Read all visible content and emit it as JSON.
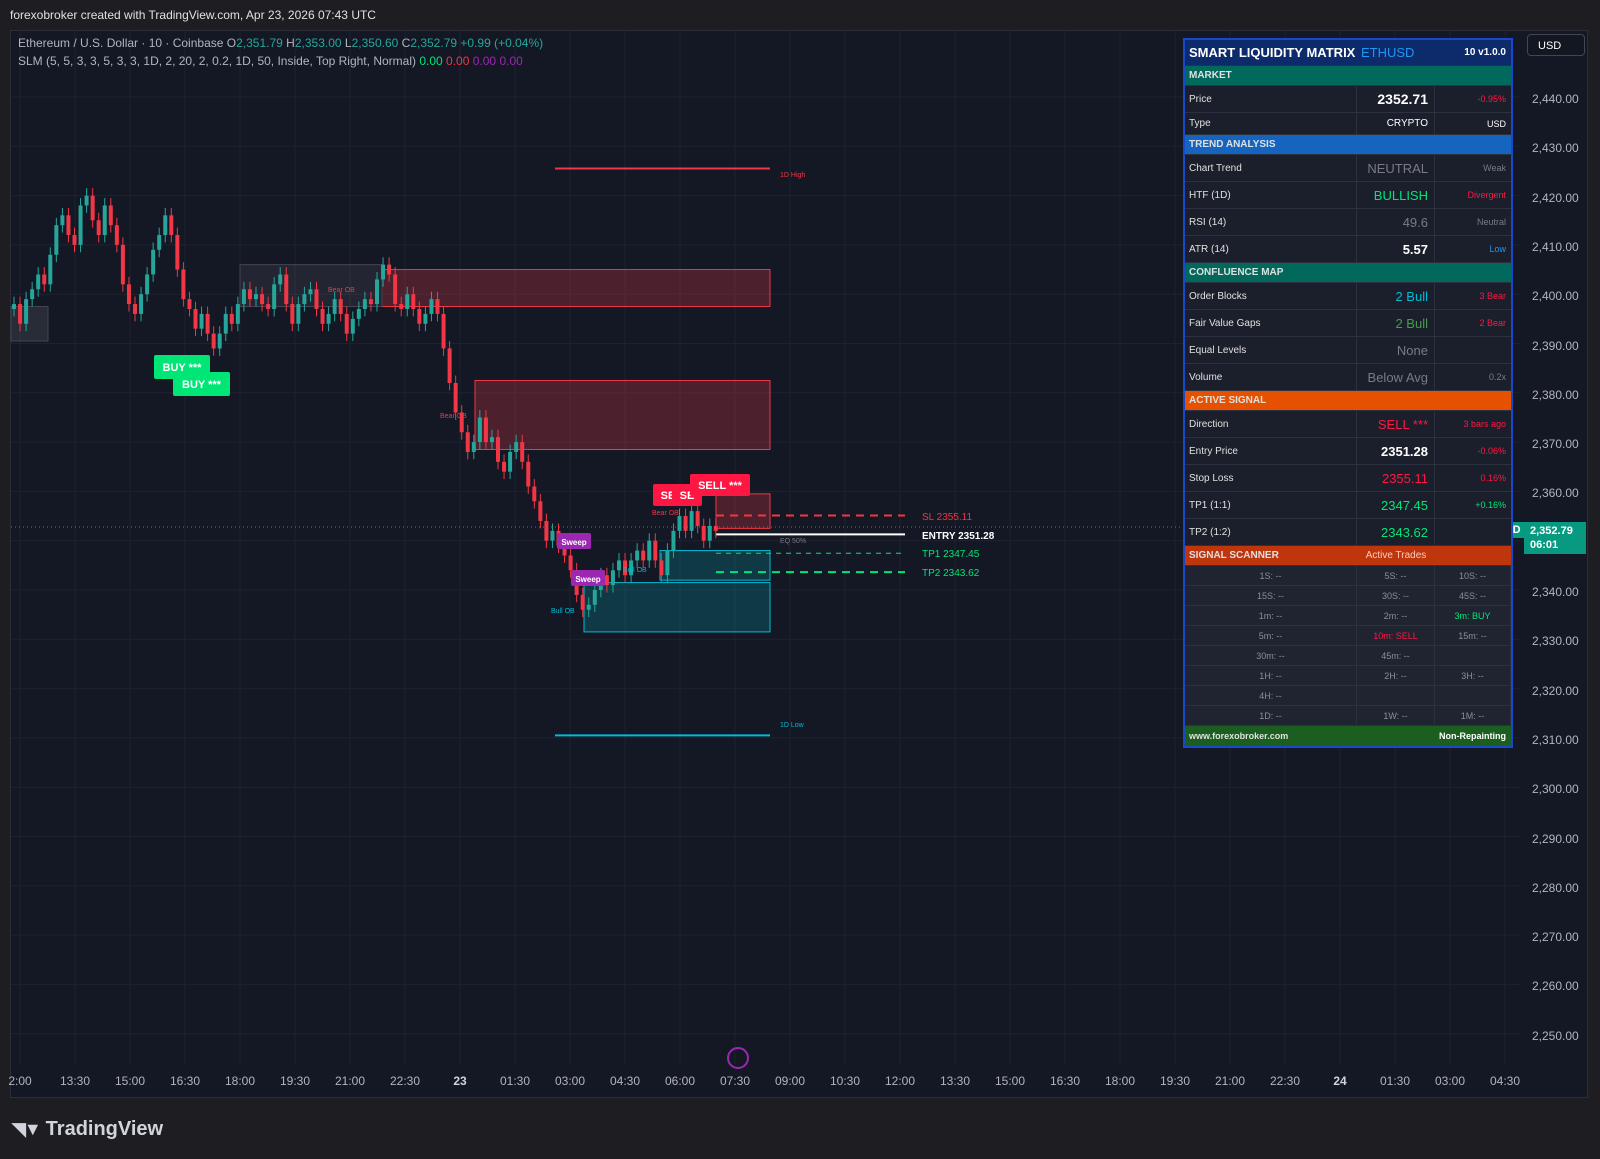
{
  "header": {
    "caption": "forexobroker created with TradingView.com, Apr 23, 2026 07:43 UTC"
  },
  "legend": {
    "symbol": "Ethereum / U.S. Dollar · 10 · Coinbase",
    "o_label": "O",
    "o": "2,351.79",
    "h_label": "H",
    "h": "2,353.00",
    "l_label": "L",
    "l": "2,350.60",
    "c_label": "C",
    "c": "2,352.79",
    "chg": "+0.99 (+0.04%)",
    "indicator": "SLM (5, 5, 3, 3, 5, 3, 3, 1D, 2, 20, 2, 0.2, 1D, 50, Inside, Top Right, Normal)",
    "v1": "0.00",
    "v2": "0.00",
    "v3": "0.00",
    "v4": "0.00"
  },
  "price_axis": {
    "currency_button": "USD",
    "ticks": [
      "2,440.00",
      "2,430.00",
      "2,420.00",
      "2,410.00",
      "2,400.00",
      "2,390.00",
      "2,380.00",
      "2,370.00",
      "2,360.00",
      "2,350.00",
      "2,340.00",
      "2,330.00",
      "2,320.00",
      "2,310.00",
      "2,300.00",
      "2,290.00",
      "2,280.00",
      "2,270.00",
      "2,260.00",
      "2,250.00"
    ],
    "current_symbol": "ETHUSD",
    "current_price": "2,352.79",
    "countdown": "06:01"
  },
  "time_axis": [
    "2:00",
    "13:30",
    "15:00",
    "16:30",
    "18:00",
    "19:30",
    "21:00",
    "22:30",
    "23",
    "01:30",
    "03:00",
    "04:30",
    "06:00",
    "07:30",
    "09:00",
    "10:30",
    "12:00",
    "13:30",
    "15:00",
    "16:30",
    "18:00",
    "19:30",
    "21:00",
    "22:30",
    "24",
    "01:30",
    "03:00",
    "04:30"
  ],
  "annotations": {
    "d_high": "1D High",
    "d_low": "1D Low",
    "sl": "SL 2355.11",
    "entry": "ENTRY 2351.28",
    "tp1": "TP1 2347.45",
    "tp2": "TP2 2343.62",
    "eq": "EQ 50%",
    "bear_ob_1": "Bear OB",
    "bear_ob_2": "Bear OB",
    "bear_ob_3": "Bear OB",
    "bull_ob_1": "Bull OB",
    "bull_ob_2": "Bull OB",
    "buy_1": "BUY ***",
    "buy_2": "BUY ***",
    "sell_1": "SE",
    "sell_2": "SE",
    "sell_3": "SELL ***",
    "sweep_1": "Sweep",
    "sweep_2": "Sweep"
  },
  "panel": {
    "title": "SMART LIQUIDITY MATRIX",
    "symbol": "ETHUSD",
    "version": "10  v1.0.0",
    "market_section": "MARKET",
    "price_label": "Price",
    "price_value": "2352.71",
    "price_change": "-0.95%",
    "type_label": "Type",
    "type_value": "CRYPTO",
    "type_currency": "USD",
    "trend_section": "TREND ANALYSIS",
    "chart_trend_label": "Chart Trend",
    "chart_trend_value": "NEUTRAL",
    "chart_trend_strength": "Weak",
    "htf_label": "HTF (1D)",
    "htf_value": "BULLISH",
    "htf_note": "Divergent",
    "rsi_label": "RSI (14)",
    "rsi_value": "49.6",
    "rsi_note": "Neutral",
    "atr_label": "ATR (14)",
    "atr_value": "5.57",
    "atr_note": "Low",
    "confluence_section": "CONFLUENCE MAP",
    "ob_label": "Order Blocks",
    "ob_bull": "2 Bull",
    "ob_bear": "3 Bear",
    "fvg_label": "Fair Value Gaps",
    "fvg_bull": "2 Bull",
    "fvg_bear": "2 Bear",
    "eq_label": "Equal Levels",
    "eq_value": "None",
    "vol_label": "Volume",
    "vol_value": "Below Avg",
    "vol_ratio": "0.2x",
    "signal_section": "ACTIVE SIGNAL",
    "dir_label": "Direction",
    "dir_value": "SELL ***",
    "dir_age": "3 bars ago",
    "entry_label": "Entry Price",
    "entry_value": "2351.28",
    "entry_pct": "-0.06%",
    "sl_label": "Stop Loss",
    "sl_value": "2355.11",
    "sl_pct": "0.16%",
    "tp1_label": "TP1 (1:1)",
    "tp1_value": "2347.45",
    "tp1_pct": "+0.16%",
    "tp2_label": "TP2 (1:2)",
    "tp2_value": "2343.62",
    "scanner_section": "SIGNAL SCANNER",
    "scanner_sub": "Active Trades",
    "scanner": [
      [
        "1S: --",
        "5S: --",
        "10S: --"
      ],
      [
        "15S: --",
        "30S: --",
        "45S: --"
      ],
      [
        "1m: --",
        "2m: --",
        "3m: BUY"
      ],
      [
        "5m: --",
        "10m: SELL",
        "15m: --"
      ],
      [
        "30m: --",
        "45m: --",
        ""
      ],
      [
        "1H: --",
        "2H: --",
        "3H: --"
      ],
      [
        "4H: --",
        "",
        ""
      ],
      [
        "1D: --",
        "1W: --",
        "1M: --"
      ]
    ],
    "footer_url": "www.forexobroker.com",
    "footer_note": "Non-Repainting"
  },
  "brand": "TradingView",
  "colors": {
    "bull": "#26a69a",
    "bear": "#f23645",
    "panel_border": "#1848cc",
    "current": "#089981"
  }
}
